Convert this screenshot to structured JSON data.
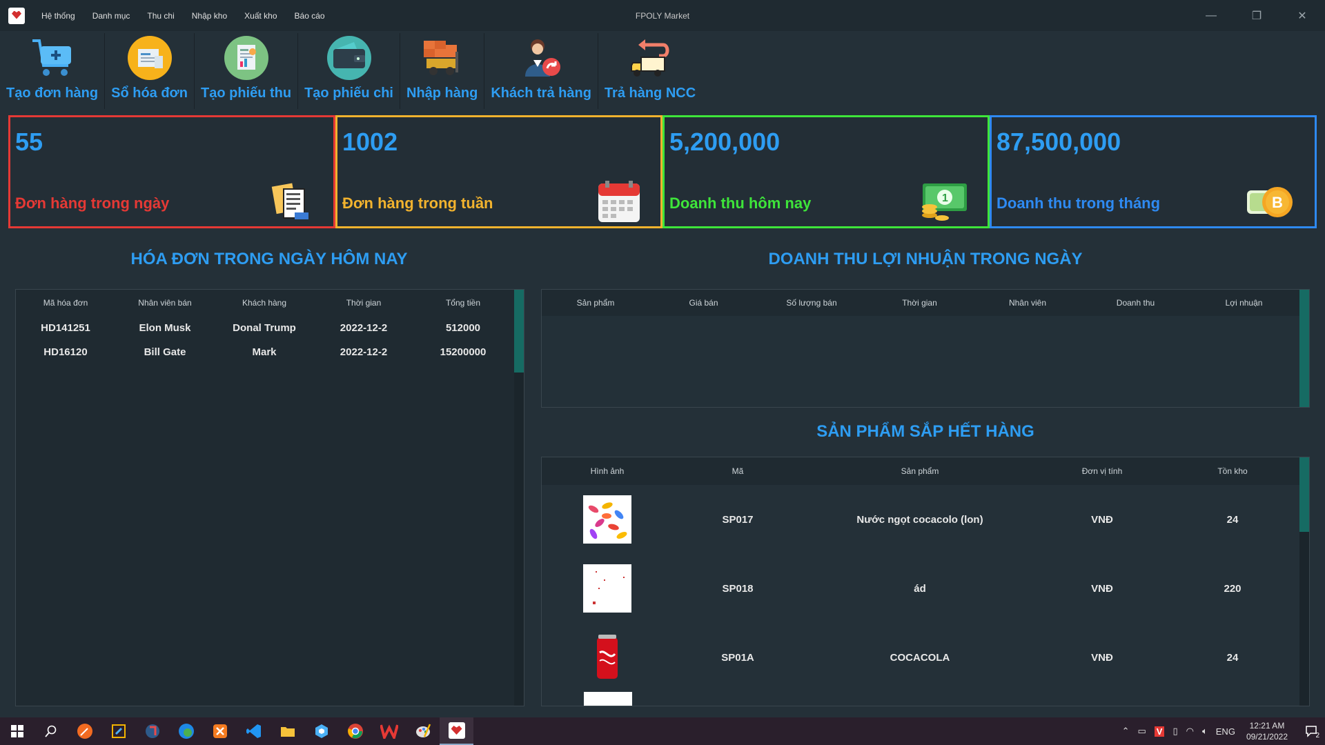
{
  "window": {
    "title": "FPOLY Market",
    "menu": [
      "Hệ thống",
      "Danh mục",
      "Thu chi",
      "Nhập kho",
      "Xuất kho",
      "Báo cáo"
    ]
  },
  "toolbar": [
    {
      "label": "Tạo đơn hàng",
      "icon": "cart-add-icon"
    },
    {
      "label": "Sổ hóa đơn",
      "icon": "invoice-book-icon"
    },
    {
      "label": "Tạo phiếu thu",
      "icon": "receipt-icon"
    },
    {
      "label": "Tạo phiếu chi",
      "icon": "wallet-icon"
    },
    {
      "label": "Nhập hàng",
      "icon": "forklift-icon"
    },
    {
      "label": "Khách trả hàng",
      "icon": "customer-return-icon"
    },
    {
      "label": "Trả hàng NCC",
      "icon": "truck-return-icon"
    }
  ],
  "cards": [
    {
      "value": "55",
      "label": "Đơn hàng trong ngày",
      "color": "#e53935",
      "icon": "orders-icon"
    },
    {
      "value": "1002",
      "label": "Đơn hàng trong tuần",
      "color": "#f2b32e",
      "icon": "calendar-icon"
    },
    {
      "value": "5,200,000",
      "label": "Doanh thu hôm nay",
      "color": "#3ee53a",
      "icon": "money-icon"
    },
    {
      "value": "87,500,000",
      "label": "Doanh thu trong tháng",
      "color": "#2e8af2",
      "icon": "bitcoin-icon"
    }
  ],
  "invoices": {
    "title": "HÓA ĐƠN TRONG NGÀY HÔM NAY",
    "columns": [
      "Mã hóa đơn",
      "Nhân viên bán",
      "Khách hàng",
      "Thời gian",
      "Tổng tiền"
    ],
    "rows": [
      [
        "HD141251",
        "Elon Musk",
        "Donal Trump",
        "2022-12-2",
        "512000"
      ],
      [
        "HD16120",
        "Bill Gate",
        "Mark",
        "2022-12-2",
        "15200000"
      ]
    ]
  },
  "profit": {
    "title": "DOANH THU LỢI NHUẬN TRONG NGÀY",
    "columns": [
      "Sản phẩm",
      "Giá bán",
      "Số lượng bán",
      "Thời gian",
      "Nhân viên",
      "Doanh thu",
      "Lợi nhuận"
    ]
  },
  "lowstock": {
    "title": "SẢN PHẨM SẮP HẾT HÀNG",
    "columns": [
      "Hình ảnh",
      "Mã",
      "Sản phẩm",
      "Đơn vị tính",
      "Tồn kho"
    ],
    "rows": [
      {
        "image": "candy-image",
        "code": "SP017",
        "name": "Nước ngọt cocacolo (lon)",
        "unit": "VNĐ",
        "stock": "24"
      },
      {
        "image": "blank-image",
        "code": "SP018",
        "name": "ád",
        "unit": "VNĐ",
        "stock": "220"
      },
      {
        "image": "cocacola-can-image",
        "code": "SP01A",
        "name": "COCACOLA",
        "unit": "VNĐ",
        "stock": "24"
      }
    ]
  },
  "taskbar": {
    "lang": "ENG",
    "time": "12:21 AM",
    "date": "09/21/2022",
    "notif": "2"
  }
}
